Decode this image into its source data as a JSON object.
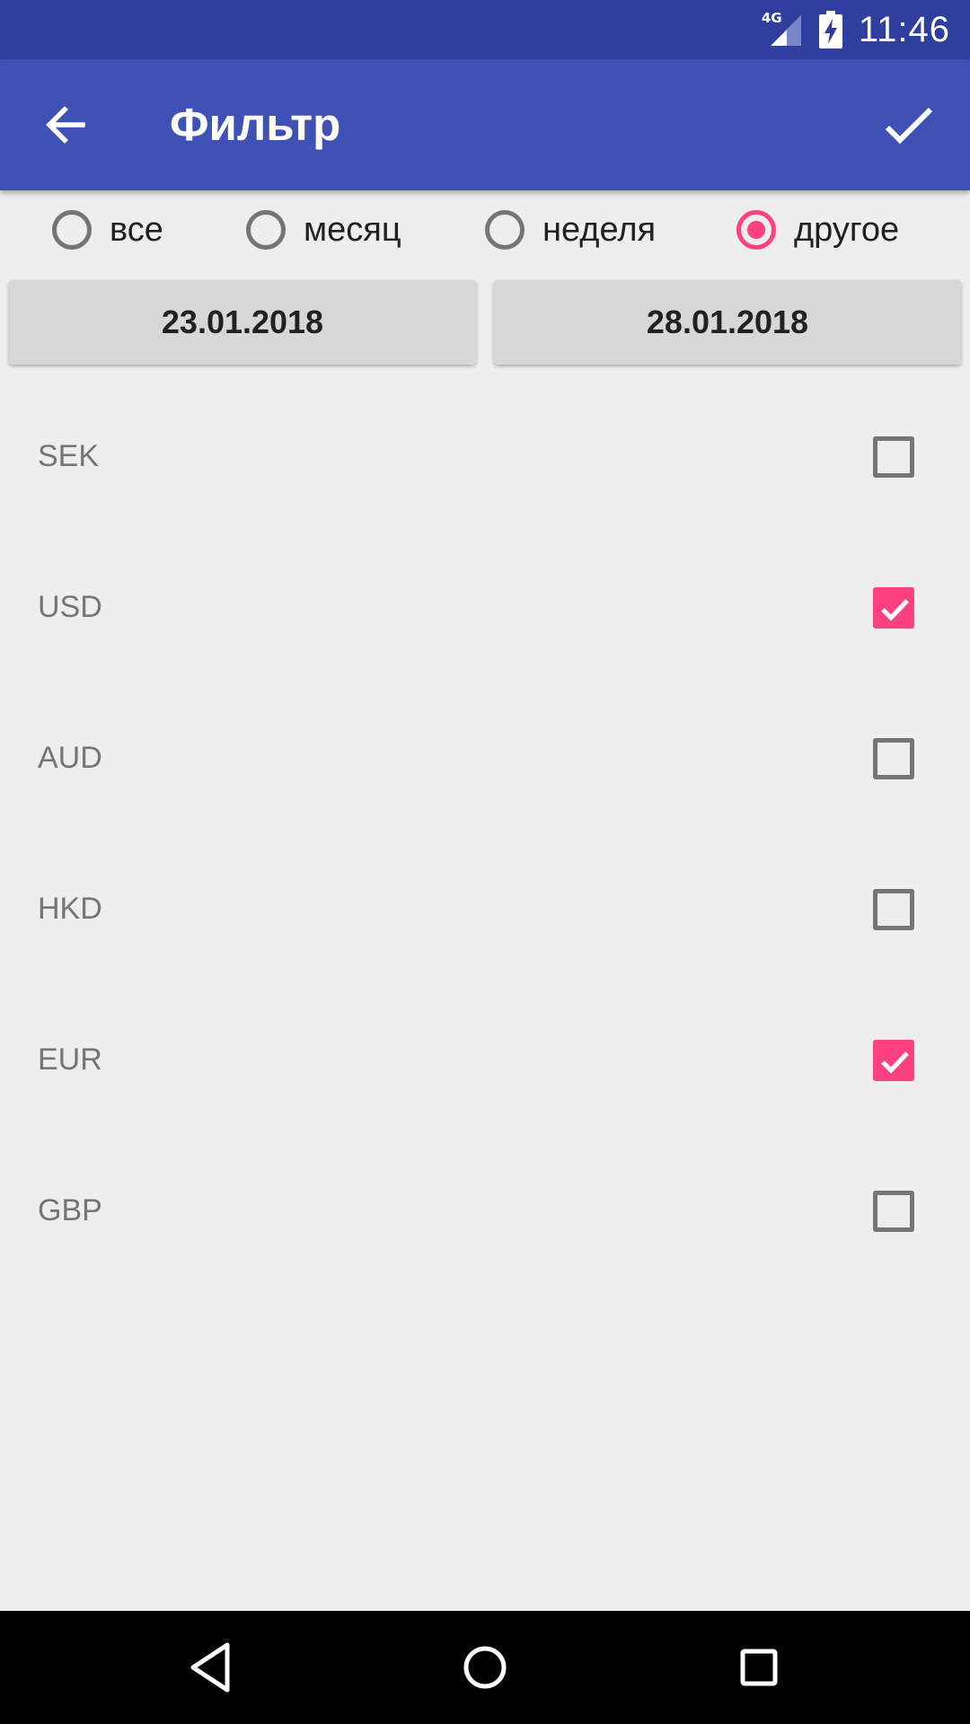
{
  "status_bar": {
    "time": "11:46",
    "network": "4G",
    "icons": [
      "signal-icon",
      "battery-charging-icon"
    ]
  },
  "app_bar": {
    "title": "Фильтр",
    "back_icon": "arrow-back-icon",
    "confirm_icon": "check-icon"
  },
  "period": {
    "options": [
      {
        "label": "все",
        "selected": false
      },
      {
        "label": "месяц",
        "selected": false
      },
      {
        "label": "неделя",
        "selected": false
      },
      {
        "label": "другое",
        "selected": true
      }
    ]
  },
  "dates": {
    "from": "23.01.2018",
    "to": "28.01.2018"
  },
  "currencies": [
    {
      "code": "SEK",
      "checked": false
    },
    {
      "code": "USD",
      "checked": true
    },
    {
      "code": "AUD",
      "checked": false
    },
    {
      "code": "HKD",
      "checked": false
    },
    {
      "code": "EUR",
      "checked": true
    },
    {
      "code": "GBP",
      "checked": false
    }
  ],
  "colors": {
    "primary": "#3f51b5",
    "primary_dark": "#303f9f",
    "accent": "#ff4081",
    "background": "#eeeeee"
  },
  "nav_bar": {
    "icons": [
      "back-triangle-icon",
      "home-circle-icon",
      "recents-square-icon"
    ]
  }
}
